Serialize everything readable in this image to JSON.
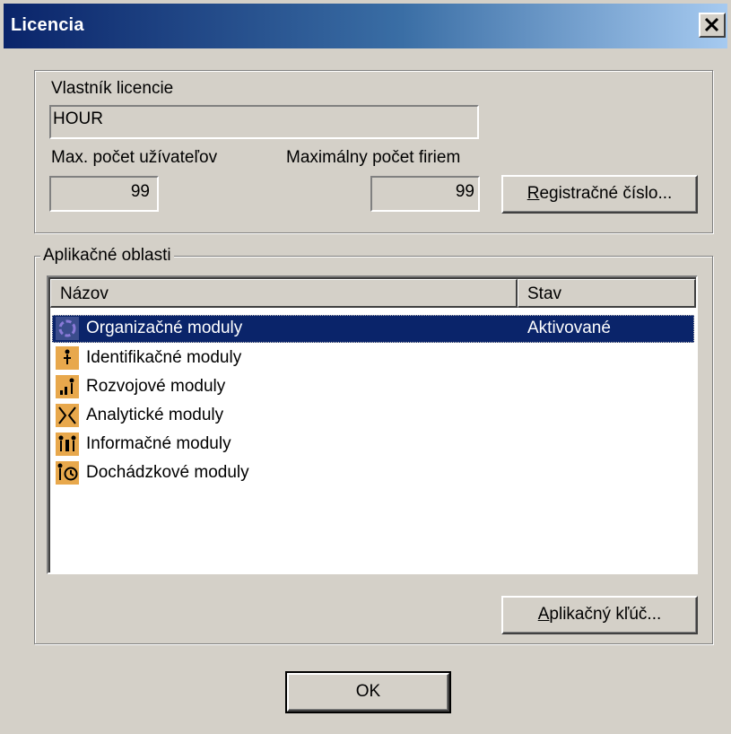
{
  "window": {
    "title": "Licencia"
  },
  "license": {
    "owner_label": "Vlastník licencie",
    "owner_value": "HOUR",
    "max_users_label": "Max. počet užívateľov",
    "max_users_value": "99",
    "max_companies_label": "Maximálny počet firiem",
    "max_companies_value": "99",
    "registration_button": {
      "accel": "R",
      "rest": "egistračné číslo..."
    }
  },
  "modules": {
    "group_label": "Aplikačné oblasti",
    "columns": [
      "Názov",
      "Stav"
    ],
    "rows": [
      {
        "name": "Organizačné moduly",
        "status": "Aktivované",
        "icon": "organization-icon",
        "selected": true
      },
      {
        "name": "Identifikačné moduly",
        "status": "",
        "icon": "identification-icon",
        "selected": false
      },
      {
        "name": "Rozvojové moduly",
        "status": "",
        "icon": "development-icon",
        "selected": false
      },
      {
        "name": "Analytické moduly",
        "status": "",
        "icon": "analytics-icon",
        "selected": false
      },
      {
        "name": "Informačné moduly",
        "status": "",
        "icon": "information-icon",
        "selected": false
      },
      {
        "name": "Dochádzkové moduly",
        "status": "",
        "icon": "attendance-icon",
        "selected": false
      }
    ],
    "app_key_button": {
      "accel": "A",
      "rest": "plikačný kľúč..."
    }
  },
  "dialog": {
    "ok_label": "OK"
  },
  "colors": {
    "window_bg": "#d4d0c8",
    "title_start": "#0a246a",
    "selection": "#0a246a",
    "icon_bg": "#e8a84c"
  }
}
